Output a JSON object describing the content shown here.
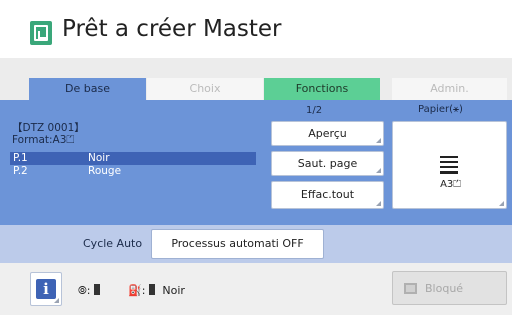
{
  "header": {
    "title": "Prêt a créer Master",
    "icon": "master-icon",
    "accent": "#3aa77a"
  },
  "tabs": [
    {
      "label": "De base",
      "state": "active"
    },
    {
      "label": "Choix",
      "state": "disabled"
    },
    {
      "label": "Fonctions",
      "state": "green"
    },
    {
      "label": "Admin.",
      "state": "disabled"
    }
  ],
  "panel": {
    "page_indicator": "1/2",
    "paper_label": "Papier(⚹)",
    "doc_id": "【DTZ 0001】",
    "format": "Format:A3⏍",
    "pages": [
      {
        "num": "P.1",
        "color": "Noir",
        "selected": true
      },
      {
        "num": "P.2",
        "color": "Rouge",
        "selected": false
      }
    ],
    "buttons": {
      "preview": "Aperçu",
      "page_skip": "Saut. page",
      "clear_all": "Effac.tout"
    },
    "paper_size": "A3⏍",
    "color": "#6c94d8"
  },
  "cycle": {
    "label": "Cycle Auto",
    "button": "Processus automati OFF"
  },
  "footer": {
    "info": "i",
    "drum_label": "⦾:",
    "ink_label": "⛽:",
    "ink_color": "Noir",
    "lock_label": "Bloqué"
  }
}
